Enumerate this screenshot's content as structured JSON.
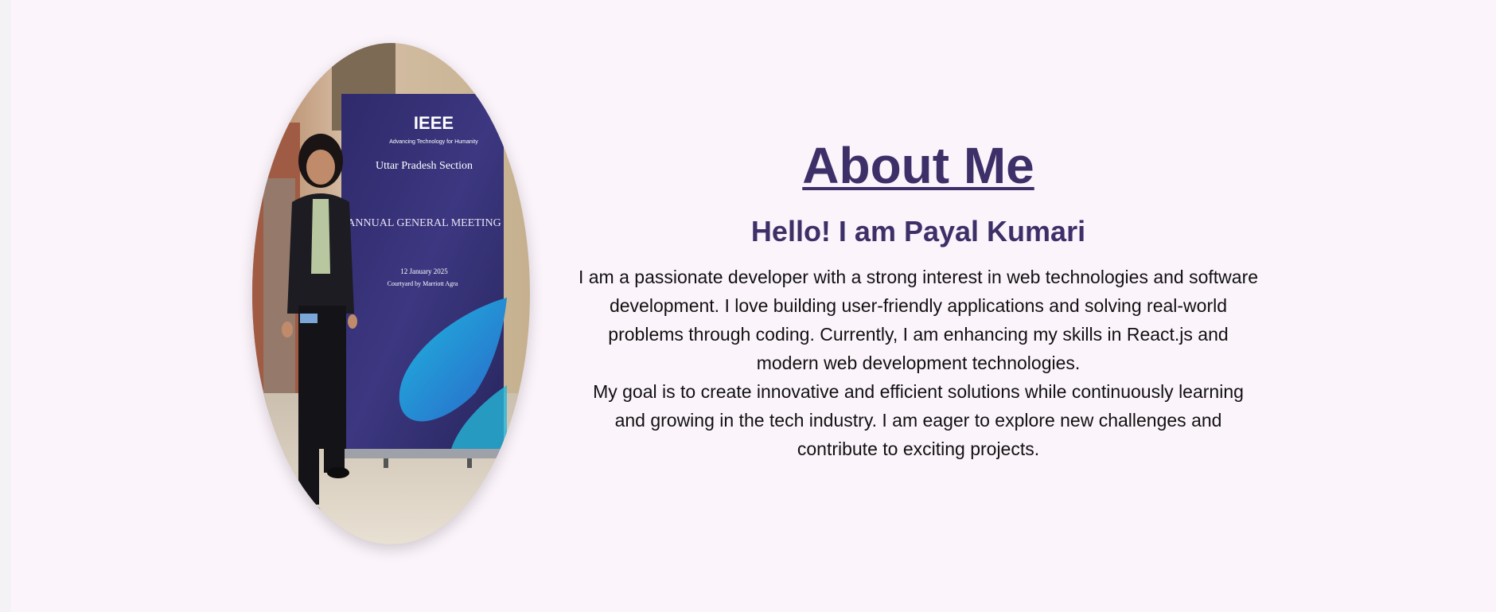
{
  "about": {
    "title": "About Me",
    "greeting": "Hello! I am Payal Kumari",
    "paragraph_1": "I am a passionate developer with a strong interest in web technologies and software development. I love building user-friendly applications and solving real-world problems through coding. Currently, I am enhancing my skills in React.js and modern web development technologies.",
    "paragraph_2": "My goal is to create innovative and efficient solutions while continuously learning and growing in the tech industry. I am eager to explore new challenges and contribute to exciting projects."
  },
  "photo": {
    "banner_org": "IEEE",
    "banner_tagline": "Advancing Technology for Humanity",
    "banner_section": "Uttar Pradesh Section",
    "banner_event": "ANNUAL GENERAL MEETING",
    "banner_date": "12 January 2025",
    "banner_venue": "Courtyard by Marriott Agra"
  },
  "colors": {
    "accent": "#3d3068",
    "background": "#fcf4fb"
  }
}
